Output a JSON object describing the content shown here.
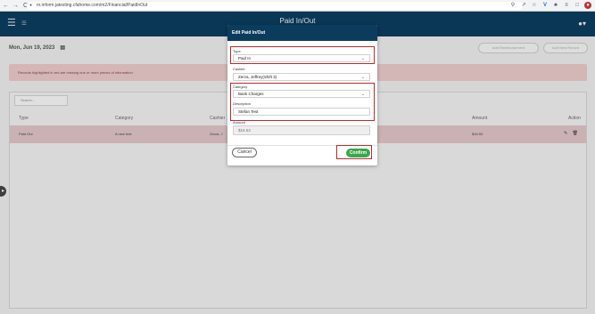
{
  "browser": {
    "url": "m.inform.jatesting.cfahome.com/m2/Financial/PaidInOut",
    "back": "←",
    "forward": "→",
    "reload": "C"
  },
  "header": {
    "title": "Paid In/Out"
  },
  "page": {
    "date": "Mon, Jun 19, 2023",
    "header_buttons": [
      "Add Reimbursement",
      "Add New Record"
    ],
    "warning": "Records highlighted in red are missing one or more pieces of information.",
    "search_placeholder": "Search...",
    "columns": [
      "Type",
      "Category",
      "Cashier",
      "Amount",
      "Action"
    ],
    "rows": [
      {
        "type": "Paid Out",
        "category": "A new test",
        "cashier": "Zerza, J",
        "amount": "$16.53"
      }
    ]
  },
  "modal": {
    "title": "Edit Paid In/Out",
    "type_label": "Type",
    "type_value": "Paid In",
    "cashier_label": "Cashier",
    "cashier_value": "Zerza, Jeffrey(Shift 3)",
    "category_label": "Category",
    "category_value": "Bank Charges",
    "description_label": "Description",
    "description_value": "Stefan Test",
    "amount_label": "Amount",
    "amount_value": "$16.53",
    "cancel_label": "Cancel",
    "confirm_label": "Confirm"
  },
  "colors": {
    "header": "#0b3c5d",
    "confirm": "#3aa84a",
    "highlight": "#c0282d",
    "warning_bg": "#e8c6c6"
  }
}
